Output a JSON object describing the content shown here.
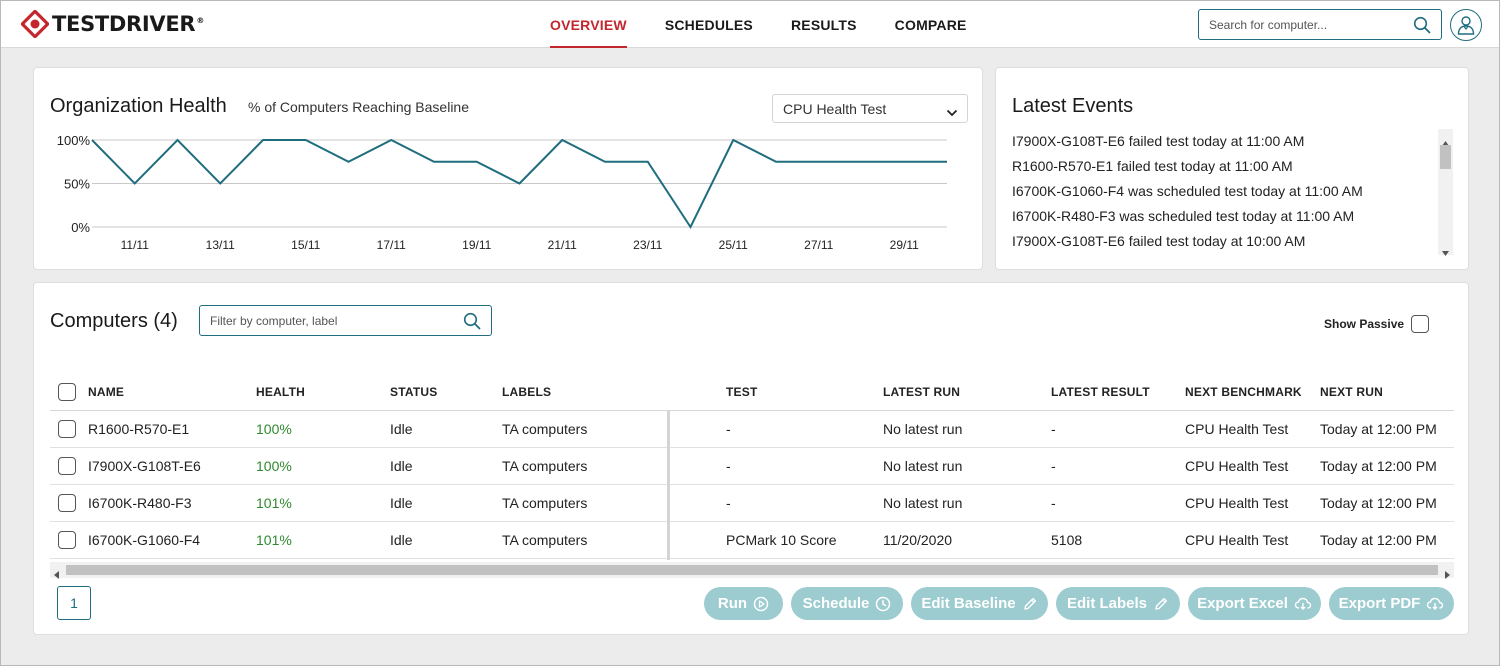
{
  "header": {
    "logo_text": "TESTDRIVER",
    "logo_reg": "®",
    "tabs": [
      {
        "label": "OVERVIEW",
        "active": true
      },
      {
        "label": "SCHEDULES",
        "active": false
      },
      {
        "label": "RESULTS",
        "active": false
      },
      {
        "label": "COMPARE",
        "active": false
      }
    ],
    "search_placeholder": "Search for computer..."
  },
  "health": {
    "title": "Organization Health",
    "subtitle": "% of Computers Reaching Baseline",
    "selected_test": "CPU Health Test"
  },
  "chart_data": {
    "type": "line",
    "x": [
      "10/11",
      "11/11",
      "12/11",
      "13/11",
      "14/11",
      "15/11",
      "16/11",
      "17/11",
      "18/11",
      "19/11",
      "20/11",
      "21/11",
      "22/11",
      "23/11",
      "24/11",
      "25/11",
      "26/11",
      "27/11",
      "28/11",
      "29/11",
      "30/11"
    ],
    "y": [
      100,
      50,
      100,
      50,
      100,
      100,
      75,
      100,
      75,
      75,
      50,
      100,
      75,
      75,
      0,
      100,
      75,
      75,
      75,
      75,
      75
    ],
    "tick_labels_x": [
      "11/11",
      "13/11",
      "15/11",
      "17/11",
      "19/11",
      "21/11",
      "23/11",
      "25/11",
      "27/11",
      "29/11"
    ],
    "tick_labels_y": [
      "100%",
      "50%",
      "0%"
    ],
    "ylim": [
      0,
      100
    ],
    "grid": true,
    "color": "#1f6d7e"
  },
  "events": {
    "title": "Latest Events",
    "items": [
      "I7900X-G108T-E6 failed test today at 11:00 AM",
      "R1600-R570-E1 failed test today at 11:00 AM",
      "I6700K-G1060-F4 was scheduled test today at 11:00 AM",
      "I6700K-R480-F3 was scheduled test today at 11:00 AM",
      "I7900X-G108T-E6 failed test today at 10:00 AM"
    ]
  },
  "computers": {
    "title": "Computers (4)",
    "filter_placeholder": "Filter by computer, label",
    "show_passive_label": "Show Passive",
    "columns": [
      "NAME",
      "HEALTH",
      "STATUS",
      "LABELS",
      "TEST",
      "LATEST RUN",
      "LATEST RESULT",
      "NEXT BENCHMARK",
      "NEXT RUN"
    ],
    "rows": [
      {
        "name": "R1600-R570-E1",
        "health": "100%",
        "status": "Idle",
        "labels": "TA computers",
        "test": "-",
        "latest_run": "No latest run",
        "latest_result": "-",
        "next_benchmark": "CPU Health Test",
        "next_run": "Today at 12:00 PM"
      },
      {
        "name": "I7900X-G108T-E6",
        "health": "100%",
        "status": "Idle",
        "labels": "TA computers",
        "test": "-",
        "latest_run": "No latest run",
        "latest_result": "-",
        "next_benchmark": "CPU Health Test",
        "next_run": "Today at 12:00 PM"
      },
      {
        "name": "I6700K-R480-F3",
        "health": "101%",
        "status": "Idle",
        "labels": "TA computers",
        "test": "-",
        "latest_run": "No latest run",
        "latest_result": "-",
        "next_benchmark": "CPU Health Test",
        "next_run": "Today at 12:00 PM"
      },
      {
        "name": "I6700K-G1060-F4",
        "health": "101%",
        "status": "Idle",
        "labels": "TA computers",
        "test": "PCMark 10 Score",
        "latest_run": "11/20/2020",
        "latest_result": "5108",
        "next_benchmark": "CPU Health Test",
        "next_run": "Today at 12:00 PM"
      }
    ],
    "page": "1",
    "actions": [
      {
        "label": "Run",
        "icon": "play-circle-icon"
      },
      {
        "label": "Schedule",
        "icon": "clock-icon"
      },
      {
        "label": "Edit Baseline",
        "icon": "pencil-icon"
      },
      {
        "label": "Edit Labels",
        "icon": "pencil-icon"
      },
      {
        "label": "Export Excel",
        "icon": "cloud-download-icon"
      },
      {
        "label": "Export PDF",
        "icon": "cloud-download-icon"
      }
    ]
  },
  "colors": {
    "brand_red": "#c4262e",
    "teal": "#1f6d7e",
    "button_teal_light": "#9ccbd0",
    "health_green": "#2f8a2f"
  }
}
